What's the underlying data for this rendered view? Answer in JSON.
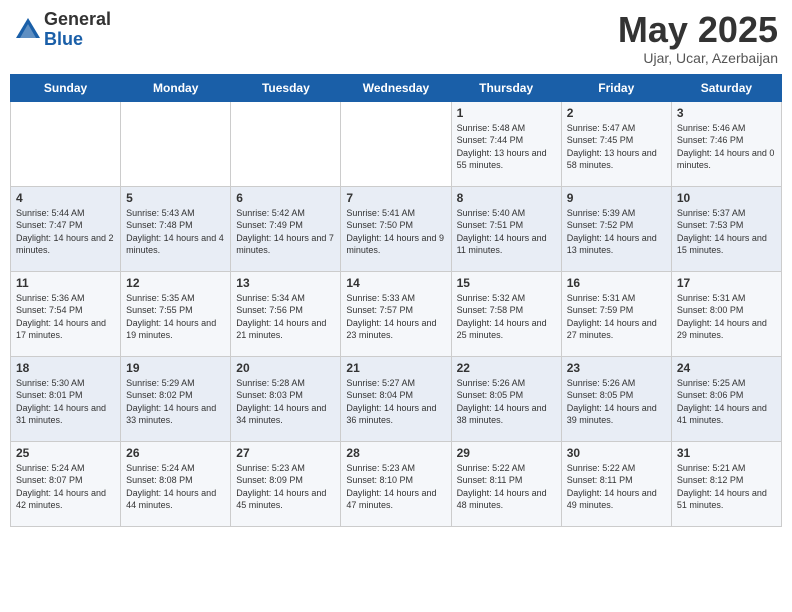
{
  "logo": {
    "general": "General",
    "blue": "Blue"
  },
  "title": "May 2025",
  "location": "Ujar, Ucar, Azerbaijan",
  "days_of_week": [
    "Sunday",
    "Monday",
    "Tuesday",
    "Wednesday",
    "Thursday",
    "Friday",
    "Saturday"
  ],
  "weeks": [
    [
      {
        "day": "",
        "sunrise": "",
        "sunset": "",
        "daylight": ""
      },
      {
        "day": "",
        "sunrise": "",
        "sunset": "",
        "daylight": ""
      },
      {
        "day": "",
        "sunrise": "",
        "sunset": "",
        "daylight": ""
      },
      {
        "day": "",
        "sunrise": "",
        "sunset": "",
        "daylight": ""
      },
      {
        "day": "1",
        "sunrise": "Sunrise: 5:48 AM",
        "sunset": "Sunset: 7:44 PM",
        "daylight": "Daylight: 13 hours and 55 minutes."
      },
      {
        "day": "2",
        "sunrise": "Sunrise: 5:47 AM",
        "sunset": "Sunset: 7:45 PM",
        "daylight": "Daylight: 13 hours and 58 minutes."
      },
      {
        "day": "3",
        "sunrise": "Sunrise: 5:46 AM",
        "sunset": "Sunset: 7:46 PM",
        "daylight": "Daylight: 14 hours and 0 minutes."
      }
    ],
    [
      {
        "day": "4",
        "sunrise": "Sunrise: 5:44 AM",
        "sunset": "Sunset: 7:47 PM",
        "daylight": "Daylight: 14 hours and 2 minutes."
      },
      {
        "day": "5",
        "sunrise": "Sunrise: 5:43 AM",
        "sunset": "Sunset: 7:48 PM",
        "daylight": "Daylight: 14 hours and 4 minutes."
      },
      {
        "day": "6",
        "sunrise": "Sunrise: 5:42 AM",
        "sunset": "Sunset: 7:49 PM",
        "daylight": "Daylight: 14 hours and 7 minutes."
      },
      {
        "day": "7",
        "sunrise": "Sunrise: 5:41 AM",
        "sunset": "Sunset: 7:50 PM",
        "daylight": "Daylight: 14 hours and 9 minutes."
      },
      {
        "day": "8",
        "sunrise": "Sunrise: 5:40 AM",
        "sunset": "Sunset: 7:51 PM",
        "daylight": "Daylight: 14 hours and 11 minutes."
      },
      {
        "day": "9",
        "sunrise": "Sunrise: 5:39 AM",
        "sunset": "Sunset: 7:52 PM",
        "daylight": "Daylight: 14 hours and 13 minutes."
      },
      {
        "day": "10",
        "sunrise": "Sunrise: 5:37 AM",
        "sunset": "Sunset: 7:53 PM",
        "daylight": "Daylight: 14 hours and 15 minutes."
      }
    ],
    [
      {
        "day": "11",
        "sunrise": "Sunrise: 5:36 AM",
        "sunset": "Sunset: 7:54 PM",
        "daylight": "Daylight: 14 hours and 17 minutes."
      },
      {
        "day": "12",
        "sunrise": "Sunrise: 5:35 AM",
        "sunset": "Sunset: 7:55 PM",
        "daylight": "Daylight: 14 hours and 19 minutes."
      },
      {
        "day": "13",
        "sunrise": "Sunrise: 5:34 AM",
        "sunset": "Sunset: 7:56 PM",
        "daylight": "Daylight: 14 hours and 21 minutes."
      },
      {
        "day": "14",
        "sunrise": "Sunrise: 5:33 AM",
        "sunset": "Sunset: 7:57 PM",
        "daylight": "Daylight: 14 hours and 23 minutes."
      },
      {
        "day": "15",
        "sunrise": "Sunrise: 5:32 AM",
        "sunset": "Sunset: 7:58 PM",
        "daylight": "Daylight: 14 hours and 25 minutes."
      },
      {
        "day": "16",
        "sunrise": "Sunrise: 5:31 AM",
        "sunset": "Sunset: 7:59 PM",
        "daylight": "Daylight: 14 hours and 27 minutes."
      },
      {
        "day": "17",
        "sunrise": "Sunrise: 5:31 AM",
        "sunset": "Sunset: 8:00 PM",
        "daylight": "Daylight: 14 hours and 29 minutes."
      }
    ],
    [
      {
        "day": "18",
        "sunrise": "Sunrise: 5:30 AM",
        "sunset": "Sunset: 8:01 PM",
        "daylight": "Daylight: 14 hours and 31 minutes."
      },
      {
        "day": "19",
        "sunrise": "Sunrise: 5:29 AM",
        "sunset": "Sunset: 8:02 PM",
        "daylight": "Daylight: 14 hours and 33 minutes."
      },
      {
        "day": "20",
        "sunrise": "Sunrise: 5:28 AM",
        "sunset": "Sunset: 8:03 PM",
        "daylight": "Daylight: 14 hours and 34 minutes."
      },
      {
        "day": "21",
        "sunrise": "Sunrise: 5:27 AM",
        "sunset": "Sunset: 8:04 PM",
        "daylight": "Daylight: 14 hours and 36 minutes."
      },
      {
        "day": "22",
        "sunrise": "Sunrise: 5:26 AM",
        "sunset": "Sunset: 8:05 PM",
        "daylight": "Daylight: 14 hours and 38 minutes."
      },
      {
        "day": "23",
        "sunrise": "Sunrise: 5:26 AM",
        "sunset": "Sunset: 8:05 PM",
        "daylight": "Daylight: 14 hours and 39 minutes."
      },
      {
        "day": "24",
        "sunrise": "Sunrise: 5:25 AM",
        "sunset": "Sunset: 8:06 PM",
        "daylight": "Daylight: 14 hours and 41 minutes."
      }
    ],
    [
      {
        "day": "25",
        "sunrise": "Sunrise: 5:24 AM",
        "sunset": "Sunset: 8:07 PM",
        "daylight": "Daylight: 14 hours and 42 minutes."
      },
      {
        "day": "26",
        "sunrise": "Sunrise: 5:24 AM",
        "sunset": "Sunset: 8:08 PM",
        "daylight": "Daylight: 14 hours and 44 minutes."
      },
      {
        "day": "27",
        "sunrise": "Sunrise: 5:23 AM",
        "sunset": "Sunset: 8:09 PM",
        "daylight": "Daylight: 14 hours and 45 minutes."
      },
      {
        "day": "28",
        "sunrise": "Sunrise: 5:23 AM",
        "sunset": "Sunset: 8:10 PM",
        "daylight": "Daylight: 14 hours and 47 minutes."
      },
      {
        "day": "29",
        "sunrise": "Sunrise: 5:22 AM",
        "sunset": "Sunset: 8:11 PM",
        "daylight": "Daylight: 14 hours and 48 minutes."
      },
      {
        "day": "30",
        "sunrise": "Sunrise: 5:22 AM",
        "sunset": "Sunset: 8:11 PM",
        "daylight": "Daylight: 14 hours and 49 minutes."
      },
      {
        "day": "31",
        "sunrise": "Sunrise: 5:21 AM",
        "sunset": "Sunset: 8:12 PM",
        "daylight": "Daylight: 14 hours and 51 minutes."
      }
    ]
  ]
}
